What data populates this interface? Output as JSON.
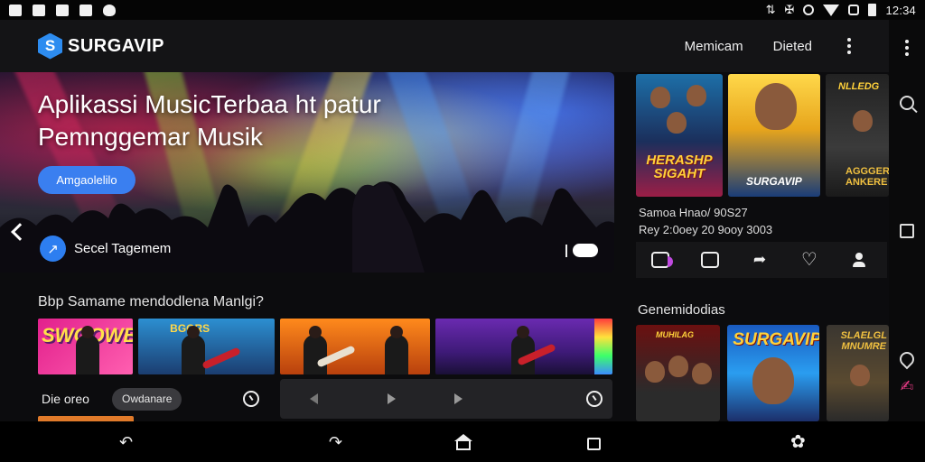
{
  "status_bar": {
    "time": "12:34",
    "left_icons": [
      "app-icon",
      "photo-icon",
      "image-icon",
      "document-icon",
      "puzzle-icon"
    ],
    "right_icons": [
      "vibrate-icon",
      "alarm-icon",
      "sync-icon",
      "wifi-icon",
      "signal-icon",
      "battery-icon"
    ]
  },
  "header": {
    "logo_letter": "S",
    "brand": "SURGAVIP",
    "nav": [
      "Memicam",
      "Dieted"
    ],
    "accent": "#2d8cf0"
  },
  "hero": {
    "title": "Aplikassi MusicTerbaa ht patur Pemnggemar Musik",
    "cta": "Amgaolelilo",
    "chip_label": "Secel Tagemem"
  },
  "section1": {
    "title": "Bbp Samame mendodlena Manlgi?",
    "tile_tags": [
      "SWGOWB",
      "BGGRS"
    ],
    "control_label": "Die oreo",
    "control_pill": "Owdanare"
  },
  "side": {
    "poster_titles": [
      "HERASHP SIGAHT",
      "SURGAVIP",
      "NLLEDG"
    ],
    "poster_subtitle": "AGGGER ANKERE",
    "meta_line1": "Samoa Hnao/ 90S27",
    "meta_line2": "Rey 2:0oey 20 9ooy 3003",
    "section_title": "Genemidodias",
    "bottom_poster_titles": [
      "MUHILAG",
      "SURGAVIP",
      "SLAELGL MNUMRE"
    ]
  },
  "nav_bar": {
    "icons": [
      "back-icon",
      "recent-apps-icon",
      "home-icon",
      "overview-icon",
      "settings-icon"
    ]
  }
}
